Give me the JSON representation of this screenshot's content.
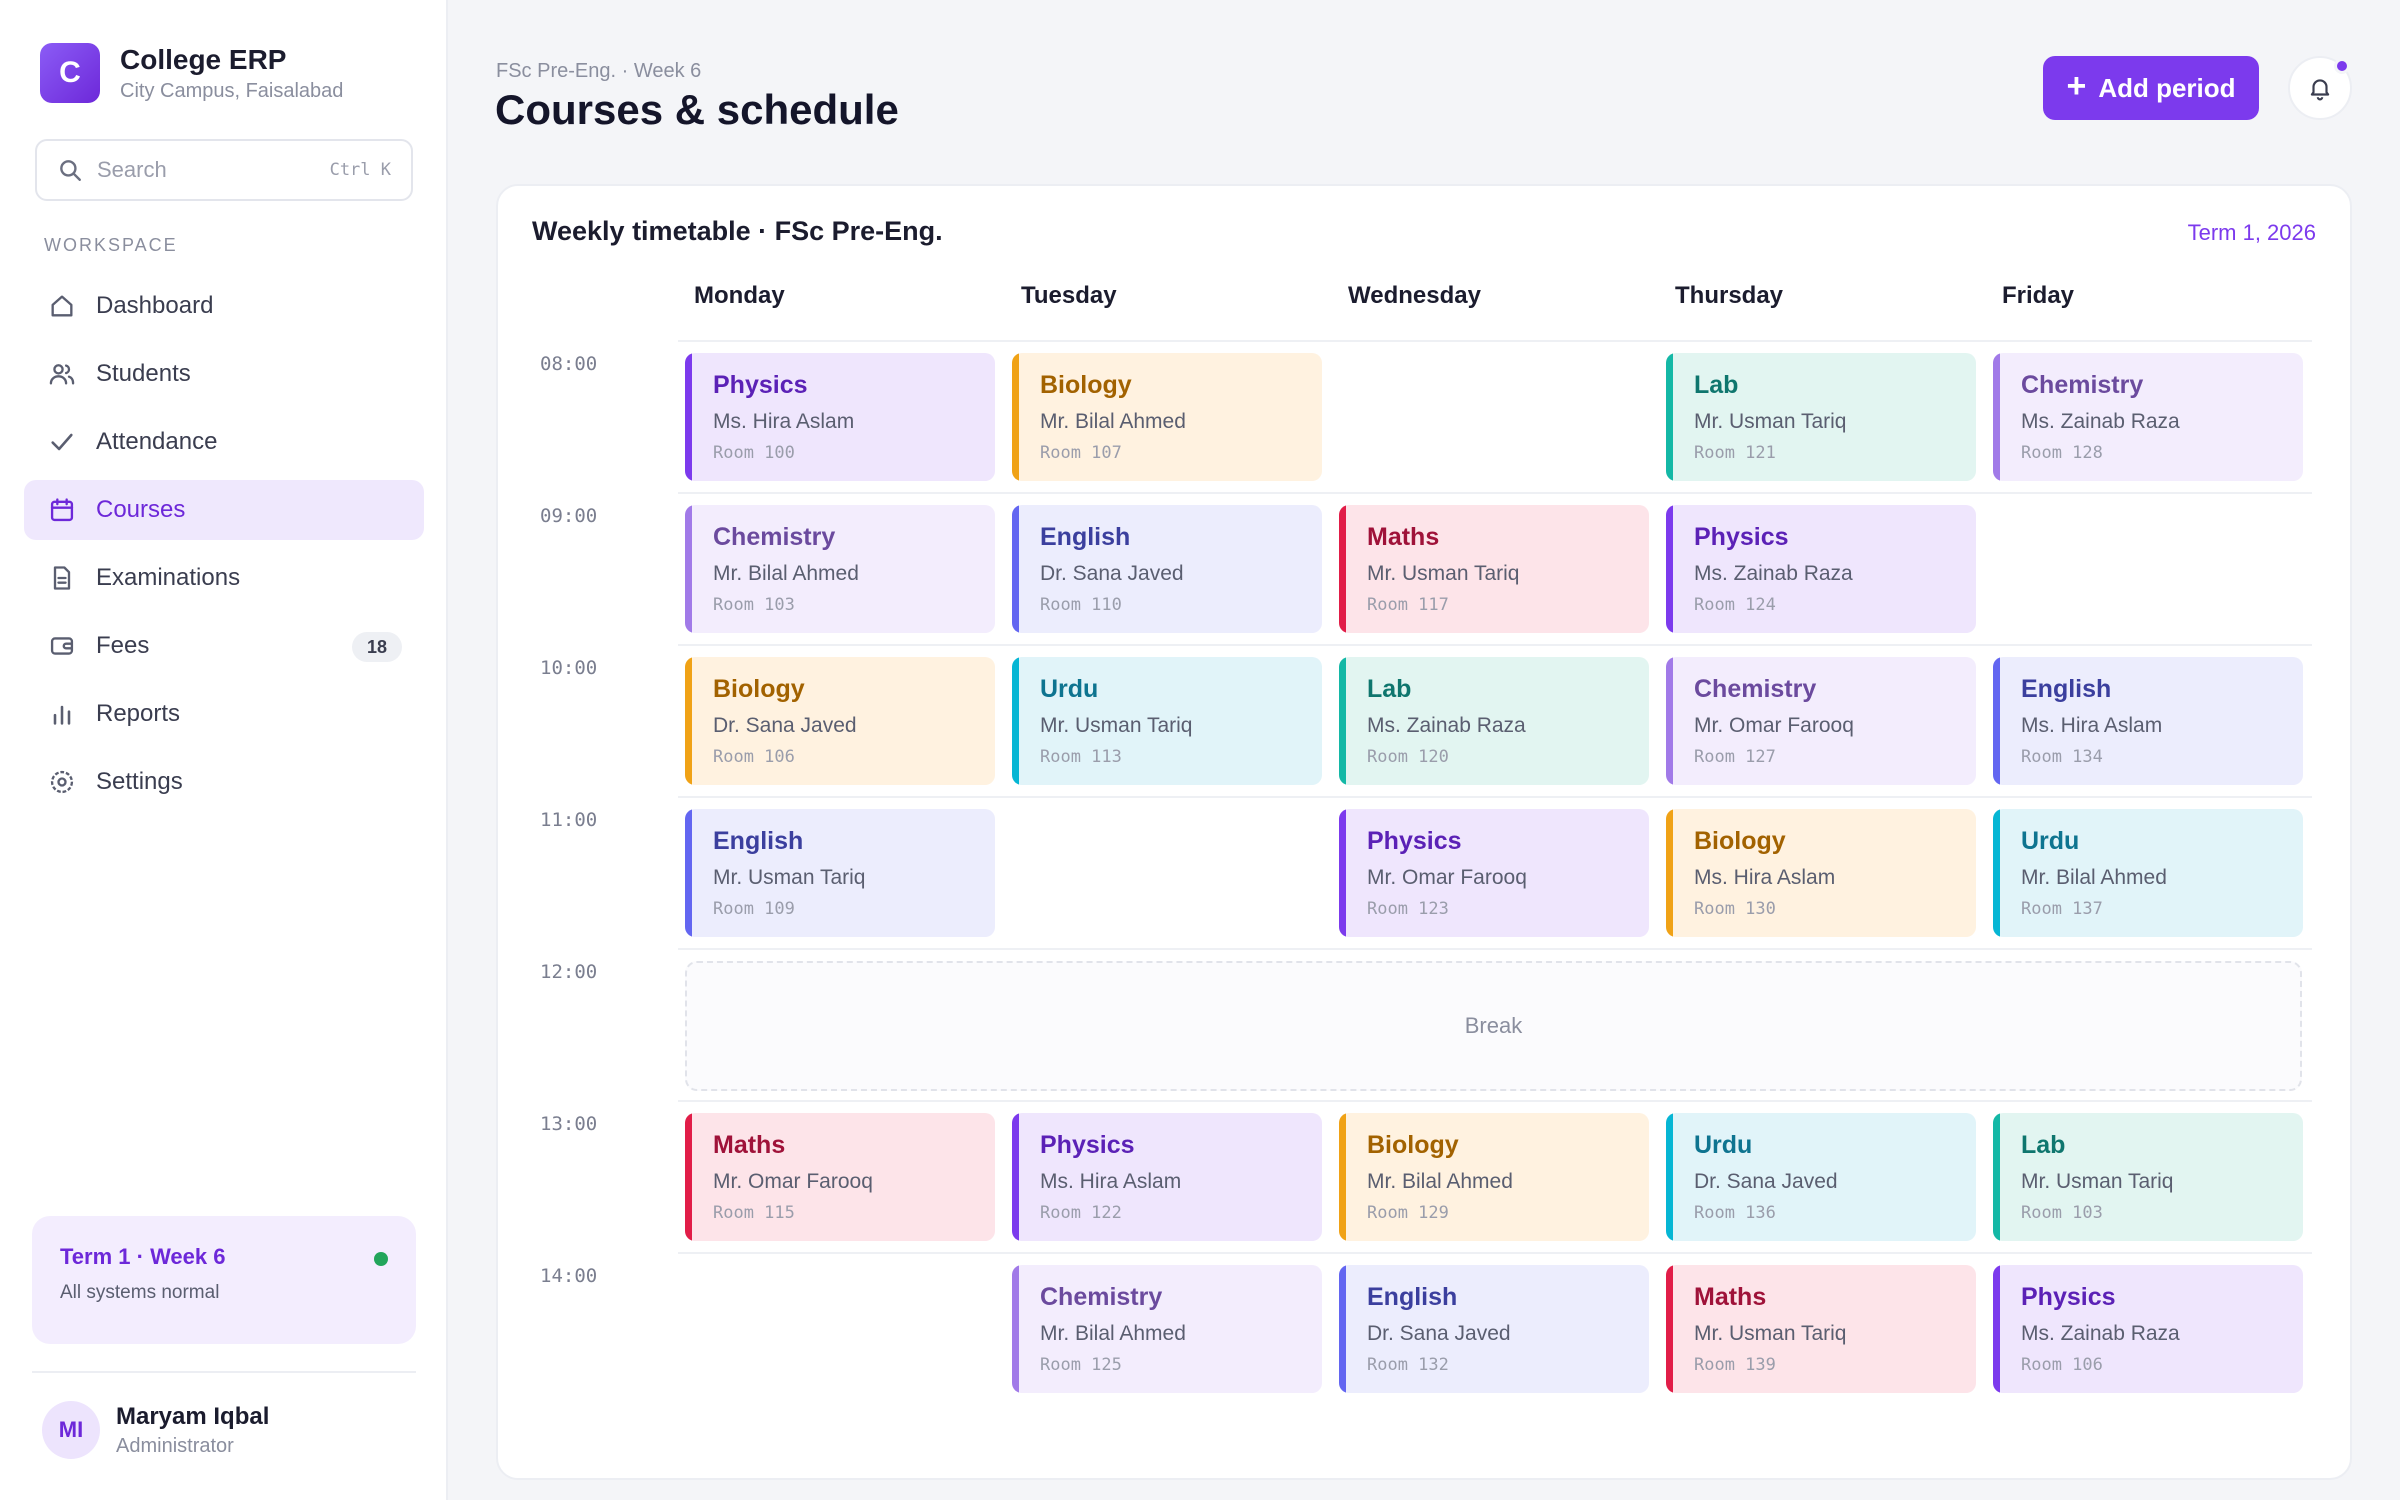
{
  "app": {
    "logo_letter": "C",
    "name": "College ERP",
    "campus": "City Campus, Faisalabad"
  },
  "search": {
    "placeholder": "Search",
    "shortcut": "Ctrl K"
  },
  "sidebar": {
    "section_label": "WORKSPACE",
    "items": [
      {
        "label": "Dashboard",
        "icon": "home-icon"
      },
      {
        "label": "Students",
        "icon": "users-icon"
      },
      {
        "label": "Attendance",
        "icon": "check-icon"
      },
      {
        "label": "Courses",
        "icon": "calendar-icon",
        "active": true
      },
      {
        "label": "Examinations",
        "icon": "document-icon"
      },
      {
        "label": "Fees",
        "icon": "wallet-icon",
        "badge": "18"
      },
      {
        "label": "Reports",
        "icon": "bar-chart-icon"
      },
      {
        "label": "Settings",
        "icon": "gear-icon"
      }
    ],
    "status": {
      "title": "Term 1 · Week 6",
      "subtitle": "All systems normal",
      "color": "#22a55b"
    },
    "user": {
      "initials": "MI",
      "name": "Maryam Iqbal",
      "role": "Administrator"
    }
  },
  "header": {
    "breadcrumb": "FSc Pre-Eng. · Week 6",
    "title": "Courses & schedule",
    "add_button": "Add period",
    "bell_icon": "bell-icon"
  },
  "timetable": {
    "title": "Weekly timetable · FSc Pre-Eng.",
    "term": "Term 1, 2026",
    "days": [
      "Monday",
      "Tuesday",
      "Wednesday",
      "Thursday",
      "Friday"
    ],
    "times": [
      "08:00",
      "09:00",
      "10:00",
      "11:00",
      "12:00",
      "13:00",
      "14:00"
    ],
    "break_label": "Break",
    "break_row": 4,
    "colors": {
      "Physics": {
        "accent": "#7c3aed",
        "bg": "#efe6fd",
        "title": "#5b21b6"
      },
      "Biology": {
        "accent": "#f0a216",
        "bg": "#fff2e0",
        "title": "#a26200"
      },
      "Lab": {
        "accent": "#14b8a6",
        "bg": "#e2f5f1",
        "title": "#0f766e"
      },
      "Chemistry": {
        "accent": "#a17ae8",
        "bg": "#f3edfd",
        "title": "#6b4a9e"
      },
      "English": {
        "accent": "#6366f1",
        "bg": "#ecedfd",
        "title": "#3b3f9e"
      },
      "Maths": {
        "accent": "#e11d48",
        "bg": "#fde4e9",
        "title": "#9f1239"
      },
      "Urdu": {
        "accent": "#06b6d4",
        "bg": "#e1f4f9",
        "title": "#0e7490"
      }
    },
    "slots": [
      {
        "day": 0,
        "row": 0,
        "subject": "Physics",
        "teacher": "Ms. Hira Aslam",
        "room": "Room 100"
      },
      {
        "day": 1,
        "row": 0,
        "subject": "Biology",
        "teacher": "Mr. Bilal Ahmed",
        "room": "Room 107"
      },
      {
        "day": 3,
        "row": 0,
        "subject": "Lab",
        "teacher": "Mr. Usman Tariq",
        "room": "Room 121"
      },
      {
        "day": 4,
        "row": 0,
        "subject": "Chemistry",
        "teacher": "Ms. Zainab Raza",
        "room": "Room 128"
      },
      {
        "day": 0,
        "row": 1,
        "subject": "Chemistry",
        "teacher": "Mr. Bilal Ahmed",
        "room": "Room 103"
      },
      {
        "day": 1,
        "row": 1,
        "subject": "English",
        "teacher": "Dr. Sana Javed",
        "room": "Room 110"
      },
      {
        "day": 2,
        "row": 1,
        "subject": "Maths",
        "teacher": "Mr. Usman Tariq",
        "room": "Room 117"
      },
      {
        "day": 3,
        "row": 1,
        "subject": "Physics",
        "teacher": "Ms. Zainab Raza",
        "room": "Room 124"
      },
      {
        "day": 0,
        "row": 2,
        "subject": "Biology",
        "teacher": "Dr. Sana Javed",
        "room": "Room 106"
      },
      {
        "day": 1,
        "row": 2,
        "subject": "Urdu",
        "teacher": "Mr. Usman Tariq",
        "room": "Room 113"
      },
      {
        "day": 2,
        "row": 2,
        "subject": "Lab",
        "teacher": "Ms. Zainab Raza",
        "room": "Room 120"
      },
      {
        "day": 3,
        "row": 2,
        "subject": "Chemistry",
        "teacher": "Mr. Omar Farooq",
        "room": "Room 127"
      },
      {
        "day": 4,
        "row": 2,
        "subject": "English",
        "teacher": "Ms. Hira Aslam",
        "room": "Room 134"
      },
      {
        "day": 0,
        "row": 3,
        "subject": "English",
        "teacher": "Mr. Usman Tariq",
        "room": "Room 109"
      },
      {
        "day": 2,
        "row": 3,
        "subject": "Physics",
        "teacher": "Mr. Omar Farooq",
        "room": "Room 123"
      },
      {
        "day": 3,
        "row": 3,
        "subject": "Biology",
        "teacher": "Ms. Hira Aslam",
        "room": "Room 130"
      },
      {
        "day": 4,
        "row": 3,
        "subject": "Urdu",
        "teacher": "Mr. Bilal Ahmed",
        "room": "Room 137"
      },
      {
        "day": 0,
        "row": 5,
        "subject": "Maths",
        "teacher": "Mr. Omar Farooq",
        "room": "Room 115"
      },
      {
        "day": 1,
        "row": 5,
        "subject": "Physics",
        "teacher": "Ms. Hira Aslam",
        "room": "Room 122"
      },
      {
        "day": 2,
        "row": 5,
        "subject": "Biology",
        "teacher": "Mr. Bilal Ahmed",
        "room": "Room 129"
      },
      {
        "day": 3,
        "row": 5,
        "subject": "Urdu",
        "teacher": "Dr. Sana Javed",
        "room": "Room 136"
      },
      {
        "day": 4,
        "row": 5,
        "subject": "Lab",
        "teacher": "Mr. Usman Tariq",
        "room": "Room 103"
      },
      {
        "day": 1,
        "row": 6,
        "subject": "Chemistry",
        "teacher": "Mr. Bilal Ahmed",
        "room": "Room 125"
      },
      {
        "day": 2,
        "row": 6,
        "subject": "English",
        "teacher": "Dr. Sana Javed",
        "room": "Room 132"
      },
      {
        "day": 3,
        "row": 6,
        "subject": "Maths",
        "teacher": "Mr. Usman Tariq",
        "room": "Room 139"
      },
      {
        "day": 4,
        "row": 6,
        "subject": "Physics",
        "teacher": "Ms. Zainab Raza",
        "room": "Room 106"
      }
    ]
  }
}
